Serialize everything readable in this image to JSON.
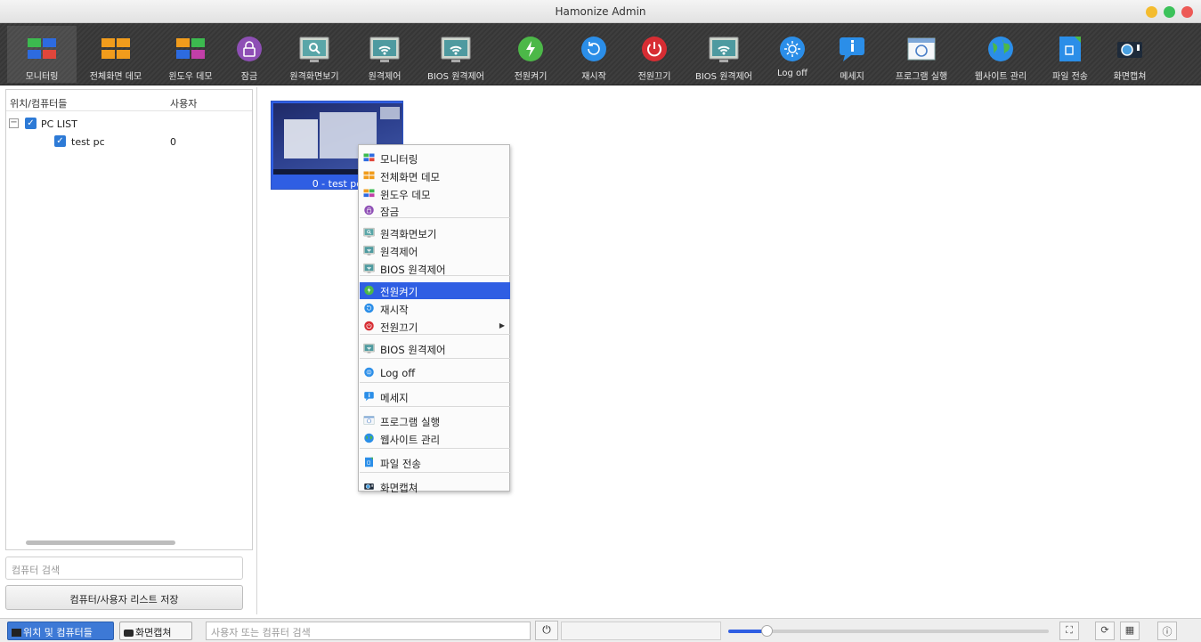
{
  "window": {
    "title": "Hamonize Admin",
    "controls": [
      {
        "name": "minimize",
        "color": "#f4bc2f"
      },
      {
        "name": "maximize",
        "color": "#3cc25a"
      },
      {
        "name": "close",
        "color": "#ed5a56"
      }
    ]
  },
  "toolbar": {
    "items": [
      {
        "id": "monitoring",
        "label": "모니터링",
        "icon": "monitoring-grid-icon"
      },
      {
        "id": "fullscreen-demo",
        "label": "전체화면 데모",
        "icon": "fullscreen-demo-icon"
      },
      {
        "id": "window-demo",
        "label": "윈도우 데모",
        "icon": "window-demo-icon"
      },
      {
        "id": "lock",
        "label": "잠금",
        "icon": "lock-icon"
      },
      {
        "id": "remote-view",
        "label": "원격화면보기",
        "icon": "remote-view-icon"
      },
      {
        "id": "remote-control",
        "label": "원격제어",
        "icon": "remote-control-icon"
      },
      {
        "id": "bios-remote",
        "label": "BIOS 원격제어",
        "icon": "bios-remote-icon"
      },
      {
        "id": "power-on",
        "label": "전원켜기",
        "icon": "power-on-icon"
      },
      {
        "id": "reboot",
        "label": "재시작",
        "icon": "reboot-icon"
      },
      {
        "id": "power-off",
        "label": "전원끄기",
        "icon": "power-off-icon"
      },
      {
        "id": "bios-remote-2",
        "label": "BIOS 원격제어",
        "icon": "bios-remote-icon"
      },
      {
        "id": "logoff",
        "label": "Log off",
        "icon": "logoff-icon"
      },
      {
        "id": "message",
        "label": "메세지",
        "icon": "message-icon"
      },
      {
        "id": "run-program",
        "label": "프로그램 실행",
        "icon": "run-program-icon"
      },
      {
        "id": "website-manage",
        "label": "웹사이트 관리",
        "icon": "globe-icon"
      },
      {
        "id": "file-transfer",
        "label": "파일 전송",
        "icon": "file-transfer-icon"
      },
      {
        "id": "screenshot",
        "label": "화면캡쳐",
        "icon": "camera-icon"
      }
    ]
  },
  "tree": {
    "col_location": "위치/컴퓨터들",
    "col_user": "사용자",
    "root_label": "PC LIST",
    "root_expander": "−",
    "children": [
      {
        "name": "test pc",
        "user": "0"
      }
    ],
    "check_glyph": "✓"
  },
  "left_search_placeholder": "컴퓨터 검색",
  "save_button_label": "컴퓨터/사용자 리스트 저장",
  "tile": {
    "caption": "0 - test pc"
  },
  "context_menu": {
    "items": [
      {
        "label": "모니터링",
        "icon": "monitoring-grid-icon"
      },
      {
        "label": "전체화면 데모",
        "icon": "fullscreen-demo-icon"
      },
      {
        "label": "윈도우 데모",
        "icon": "window-demo-icon"
      },
      {
        "label": "잠금",
        "icon": "lock-icon"
      },
      {
        "label": "원격화면보기",
        "icon": "remote-view-icon"
      },
      {
        "label": "원격제어",
        "icon": "remote-control-icon"
      },
      {
        "label": "BIOS 원격제어",
        "icon": "bios-remote-icon"
      },
      {
        "label": "전원켜기",
        "icon": "power-on-icon",
        "highlighted": true
      },
      {
        "label": "재시작",
        "icon": "reboot-icon"
      },
      {
        "label": "전원끄기",
        "icon": "power-off-icon",
        "submenu": true
      },
      {
        "label": "BIOS 원격제어",
        "icon": "bios-remote-icon"
      },
      {
        "label": "Log off",
        "icon": "logoff-icon"
      },
      {
        "label": "메세지",
        "icon": "message-icon"
      },
      {
        "label": "프로그램 실행",
        "icon": "run-program-icon"
      },
      {
        "label": "웹사이트 관리",
        "icon": "globe-icon"
      },
      {
        "label": "파일 전송",
        "icon": "file-transfer-icon"
      },
      {
        "label": "화면캡쳐",
        "icon": "camera-icon"
      }
    ],
    "submenu_arrow": "▶"
  },
  "statusbar": {
    "tab_locations": "위치 및 컴퓨터들",
    "tab_screenshot": "화면캡쳐",
    "search_placeholder": "사용자 또는 컴퓨터 검색",
    "power_glyph": "⏻",
    "zoom_level": 0.12,
    "icon_fit": "⛶",
    "icon_autofit": "⟳",
    "icon_grid": "▦",
    "icon_about": "ⓘ"
  },
  "colors": {
    "accent": "#2f5ee3",
    "toolbar_bg": "#3a3a3a",
    "highlight": "#2f5ee3"
  }
}
